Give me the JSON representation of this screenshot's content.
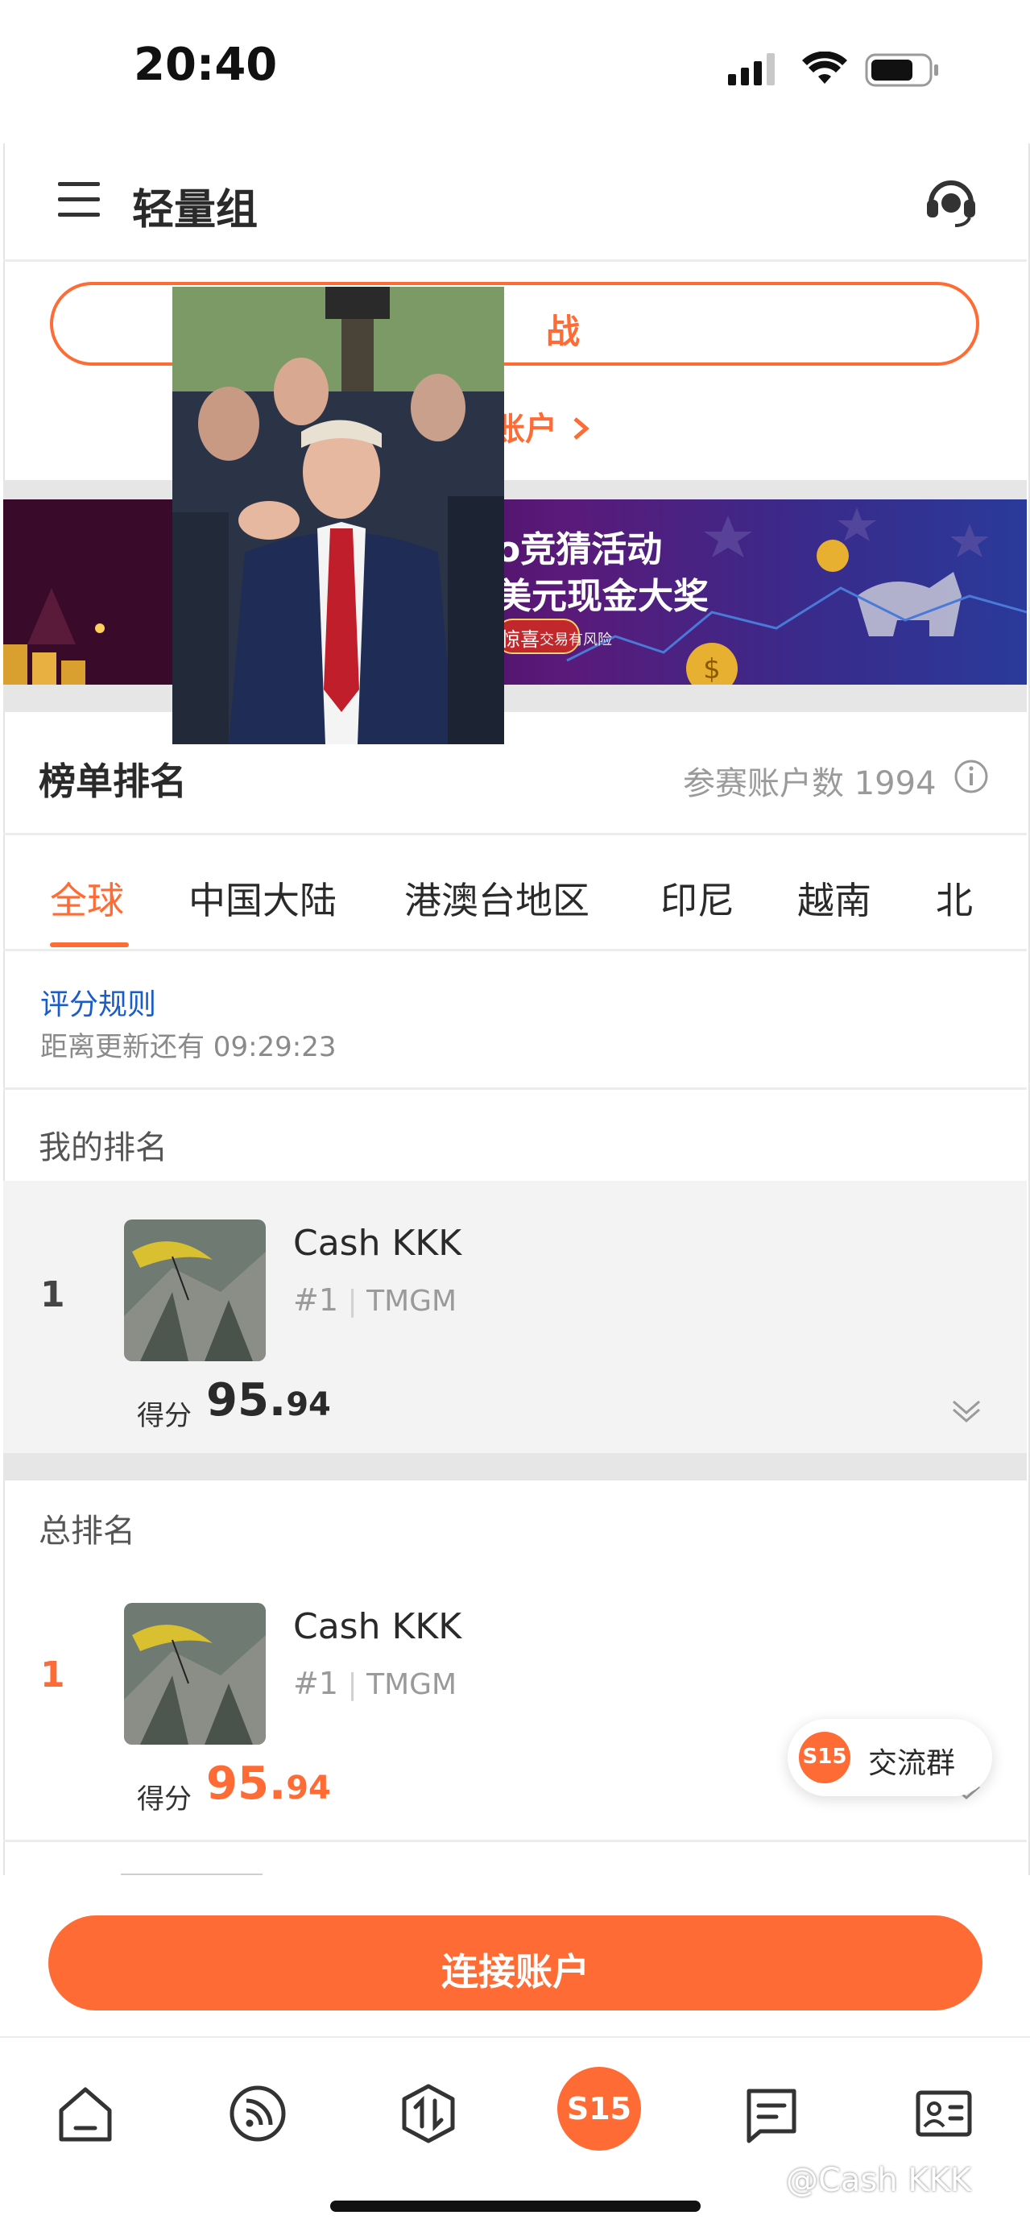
{
  "status_bar": {
    "time": "20:40",
    "battery_level": 0.75
  },
  "header": {
    "title": "轻量组",
    "menu_icon": "hamburger-icon",
    "support_icon": "headset-icon"
  },
  "challenge": {
    "button_label_partial": "战",
    "link_partial": "账户"
  },
  "banner": {
    "line1": "o竞猜活动",
    "line2": "美元现金大奖",
    "button_partial": "惊喜",
    "risk_note": "交易有风险"
  },
  "leaderboard": {
    "title": "榜单排名",
    "participants_label": "参赛账户数",
    "participants_count": "1994",
    "tabs": [
      {
        "label": "全球",
        "active": true
      },
      {
        "label": "中国大陆",
        "active": false
      },
      {
        "label": "港澳台地区",
        "active": false
      },
      {
        "label": "印尼",
        "active": false
      },
      {
        "label": "越南",
        "active": false
      },
      {
        "label": "北",
        "active": false
      }
    ],
    "rules_link": "评分规则",
    "update_countdown": "距离更新还有 09:29:23"
  },
  "my_rank": {
    "section_label": "我的排名",
    "rank": "1",
    "name": "Cash KKK",
    "hash": "#1",
    "broker": "TMGM",
    "score_label": "得分",
    "score_int": "95.",
    "score_dec": "94"
  },
  "overall_rank": {
    "section_label": "总排名",
    "rank": "1",
    "name": "Cash KKK",
    "hash": "#1",
    "broker": "TMGM",
    "score_label": "得分",
    "score_int": "95.",
    "score_dec": "94"
  },
  "community_chip": {
    "logo_text": "S15",
    "label": "交流群"
  },
  "connect_button": {
    "label": "连接账户"
  },
  "tabbar": {
    "items": [
      {
        "icon": "home-icon"
      },
      {
        "icon": "feed-icon"
      },
      {
        "icon": "trade-icon"
      },
      {
        "icon": "s15-logo-icon",
        "text": "S15"
      },
      {
        "icon": "message-icon"
      },
      {
        "icon": "profile-card-icon"
      }
    ]
  },
  "watermark": "@Cash KKK",
  "colors": {
    "accent": "#ff6b35",
    "link": "#1a5dc8",
    "muted": "#9a9a9a"
  }
}
